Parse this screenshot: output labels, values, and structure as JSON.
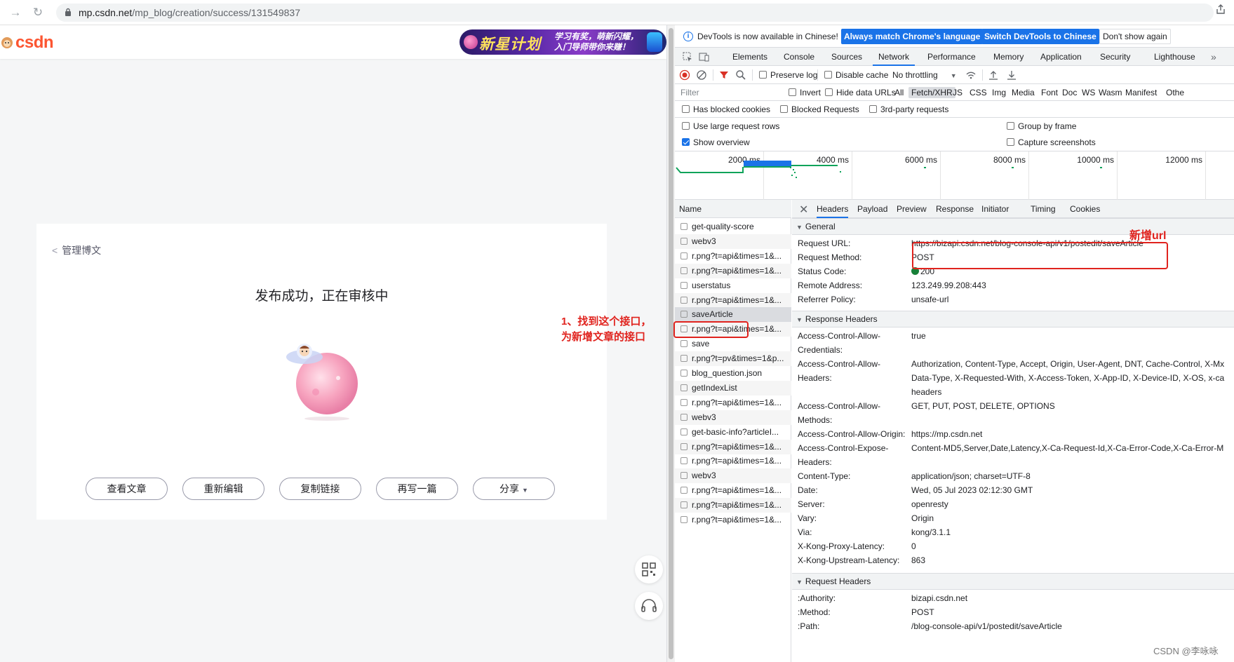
{
  "browser": {
    "url_host": "mp.csdn.net",
    "url_path": "/mp_blog/creation/success/131549837"
  },
  "page": {
    "logo_text": "csdn",
    "banner_main": "新星计划",
    "banner_sub_1": "学习有奖，萌新闪耀，",
    "banner_sub_2": "入门导师带你来赚！",
    "back_label": "管理博文",
    "title": "发布成功，正在审核中",
    "buttons": [
      "查看文章",
      "重新编辑",
      "复制链接",
      "再写一篇",
      "分享"
    ]
  },
  "annotations": {
    "left_line1": "1、找到这个接口，",
    "left_line2": "为新增文章的接口",
    "right": "新增url"
  },
  "devtools": {
    "info_message": "DevTools is now available in Chinese!",
    "btn_match": "Always match Chrome's language",
    "btn_switch": "Switch DevTools to Chinese",
    "btn_dont": "Don't show again",
    "tabs": [
      "Elements",
      "Console",
      "Sources",
      "Network",
      "Performance",
      "Memory",
      "Application",
      "Security",
      "Lighthouse"
    ],
    "active_tab": "Network",
    "toolbar": {
      "preserve_log": "Preserve log",
      "disable_cache": "Disable cache",
      "throttling": "No throttling"
    },
    "filter": {
      "placeholder": "Filter",
      "invert": "Invert",
      "hide_data_urls": "Hide data URLs",
      "types": [
        "All",
        "Fetch/XHR",
        "JS",
        "CSS",
        "Img",
        "Media",
        "Font",
        "Doc",
        "WS",
        "Wasm",
        "Manifest",
        "Othe"
      ],
      "active_type": "Fetch/XHR"
    },
    "filter2": {
      "blocked_cookies": "Has blocked cookies",
      "blocked_requests": "Blocked Requests",
      "third_party": "3rd-party requests"
    },
    "options": {
      "large_rows": "Use large request rows",
      "show_overview": "Show overview",
      "group_by_frame": "Group by frame",
      "capture_screenshots": "Capture screenshots"
    },
    "overview_ticks": [
      "2000 ms",
      "4000 ms",
      "6000 ms",
      "8000 ms",
      "10000 ms",
      "12000 ms"
    ],
    "name_header": "Name",
    "requests": [
      "get-quality-score",
      "webv3",
      "r.png?t=api&times=1&...",
      "r.png?t=api&times=1&...",
      "userstatus",
      "r.png?t=api&times=1&...",
      "saveArticle",
      "r.png?t=api&times=1&...",
      "save",
      "r.png?t=pv&times=1&p...",
      "blog_question.json",
      "getIndexList",
      "r.png?t=api&times=1&...",
      "webv3",
      "get-basic-info?articleI...",
      "r.png?t=api&times=1&...",
      "r.png?t=api&times=1&...",
      "webv3",
      "r.png?t=api&times=1&...",
      "r.png?t=api&times=1&...",
      "r.png?t=api&times=1&..."
    ],
    "selected_request": "saveArticle",
    "detail_tabs": [
      "Headers",
      "Payload",
      "Preview",
      "Response",
      "Initiator",
      "Timing",
      "Cookies"
    ],
    "active_detail_tab": "Headers",
    "general_header": "General",
    "general": [
      {
        "k": "Request URL:",
        "v": "https://bizapi.csdn.net/blog-console-api/v1/postedit/saveArticle"
      },
      {
        "k": "Request Method:",
        "v": "POST"
      },
      {
        "k": "Status Code:",
        "v": "200"
      },
      {
        "k": "Remote Address:",
        "v": "123.249.99.208:443"
      },
      {
        "k": "Referrer Policy:",
        "v": "unsafe-url"
      }
    ],
    "response_header": "Response Headers",
    "response": {
      "acac_k1": "Access-Control-Allow-",
      "acac_k2": "Credentials:",
      "acac_v": "true",
      "acah_k1": "Access-Control-Allow-",
      "acah_k2": "Headers:",
      "acah_v1": "Authorization, Content-Type, Accept, Origin, User-Agent, DNT, Cache-Control, X-Mx",
      "acah_v2": "Data-Type, X-Requested-With, X-Access-Token, X-App-ID, X-Device-ID, X-OS, x-ca",
      "acah_v3": "headers",
      "acam_k1": "Access-Control-Allow-",
      "acam_k2": "Methods:",
      "acam_v": "GET, PUT, POST, DELETE, OPTIONS",
      "acao_k": "Access-Control-Allow-Origin:",
      "acao_v": "https://mp.csdn.net",
      "aceh_k1": "Access-Control-Expose-",
      "aceh_k2": "Headers:",
      "aceh_v": "Content-MD5,Server,Date,Latency,X-Ca-Request-Id,X-Ca-Error-Code,X-Ca-Error-M",
      "ct_k": "Content-Type:",
      "ct_v": "application/json; charset=UTF-8",
      "date_k": "Date:",
      "date_v": "Wed, 05 Jul 2023 02:12:30 GMT",
      "server_k": "Server:",
      "server_v": "openresty",
      "vary_k": "Vary:",
      "vary_v": "Origin",
      "via_k": "Via:",
      "via_v": "kong/3.1.1",
      "kpl_k": "X-Kong-Proxy-Latency:",
      "kpl_v": "0",
      "kul_k": "X-Kong-Upstream-Latency:",
      "kul_v": "863"
    },
    "request_header": "Request Headers",
    "request": [
      {
        "k": ":Authority:",
        "v": "bizapi.csdn.net"
      },
      {
        "k": ":Method:",
        "v": "POST"
      },
      {
        "k": ":Path:",
        "v": "/blog-console-api/v1/postedit/saveArticle"
      }
    ]
  },
  "watermark": "CSDN @李咏咏",
  "colors": {
    "accent_blue": "#1a73e8",
    "annotation_red": "#e0231e",
    "csdn_red": "#fc5531",
    "status_green": "#188038"
  }
}
